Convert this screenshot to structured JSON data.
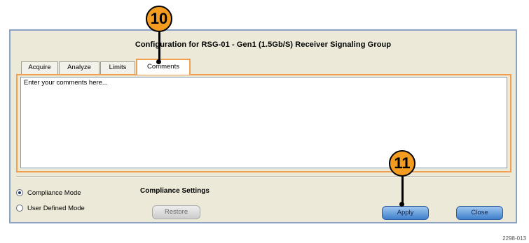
{
  "window": {
    "title": "Configuration for RSG-01 - Gen1 (1.5Gb/S) Receiver Signaling Group"
  },
  "tabs": [
    {
      "label": "Acquire",
      "active": false
    },
    {
      "label": "Analyze",
      "active": false
    },
    {
      "label": "Limits",
      "active": false
    },
    {
      "label": "Comments",
      "active": true
    }
  ],
  "comments": {
    "text": "Enter your comments here..."
  },
  "modes": {
    "compliance_label": "Compliance Mode",
    "compliance_selected": true,
    "user_defined_label": "User Defined Mode",
    "user_defined_selected": false
  },
  "settings": {
    "section_label": "Compliance Settings",
    "restore_label": "Restore"
  },
  "buttons": {
    "apply_label": "Apply",
    "close_label": "Close"
  },
  "callouts": {
    "tab_callout": "10",
    "apply_callout": "11"
  },
  "figure_id": "2298-013",
  "colors": {
    "accent_orange": "#f39c1f",
    "tab_highlight": "#f0a050",
    "window_bg": "#ece9d8",
    "button_blue": "#3f7fcc"
  }
}
